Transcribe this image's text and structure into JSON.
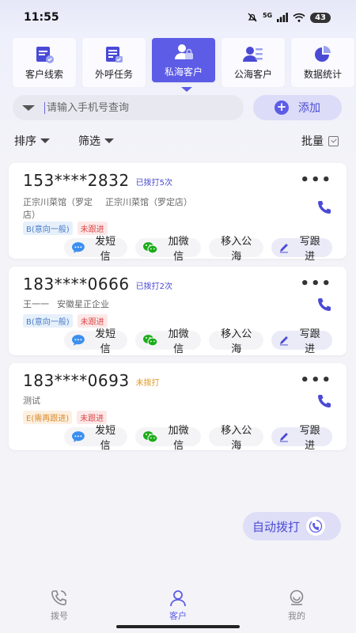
{
  "status_bar": {
    "time": "11:55",
    "network": "5G",
    "battery": "43"
  },
  "tabs": [
    {
      "label": "客户线索",
      "icon": "clipboard-check-icon",
      "active": false
    },
    {
      "label": "外呼任务",
      "icon": "task-list-icon",
      "active": false
    },
    {
      "label": "私海客户",
      "icon": "person-lock-icon",
      "active": true
    },
    {
      "label": "公海客户",
      "icon": "person-list-icon",
      "active": false
    },
    {
      "label": "数据统计",
      "icon": "pie-chart-icon",
      "active": false
    }
  ],
  "search": {
    "placeholder": "请输入手机号查询",
    "add_label": "添加"
  },
  "filters": {
    "sort_label": "排序",
    "filter_label": "筛选",
    "batch_label": "批量"
  },
  "customers": [
    {
      "phone": "153****2832",
      "dial_status": "已拨打5次",
      "company1": "正宗川菜馆（罗定店）",
      "company2": "正宗川菜馆（罗定店）",
      "tag_level": "B(意向一般)",
      "tag_follow": "未跟进"
    },
    {
      "phone": "183****0666",
      "dial_status": "已拨打2次",
      "company1": "王一一",
      "company2": "安徽星正企业",
      "tag_level": "B(意向一般)",
      "tag_follow": "未跟进"
    },
    {
      "phone": "183****0693",
      "dial_status": "未拨打",
      "company1": "测试",
      "company2": "",
      "tag_level": "E(需再跟进)",
      "tag_follow": "未跟进"
    }
  ],
  "card_actions": {
    "sms": "发短信",
    "wechat": "加微信",
    "public": "移入公海",
    "follow": "写跟进"
  },
  "auto_dial_label": "自动拨打",
  "bottom_nav": [
    {
      "label": "拨号",
      "icon": "phone-dial-icon",
      "active": false
    },
    {
      "label": "客户",
      "icon": "customer-icon",
      "active": true
    },
    {
      "label": "我的",
      "icon": "profile-icon",
      "active": false
    }
  ],
  "colors": {
    "accent": "#5d5ce6",
    "wechat": "#1aad19",
    "sms": "#3b8ff0"
  }
}
